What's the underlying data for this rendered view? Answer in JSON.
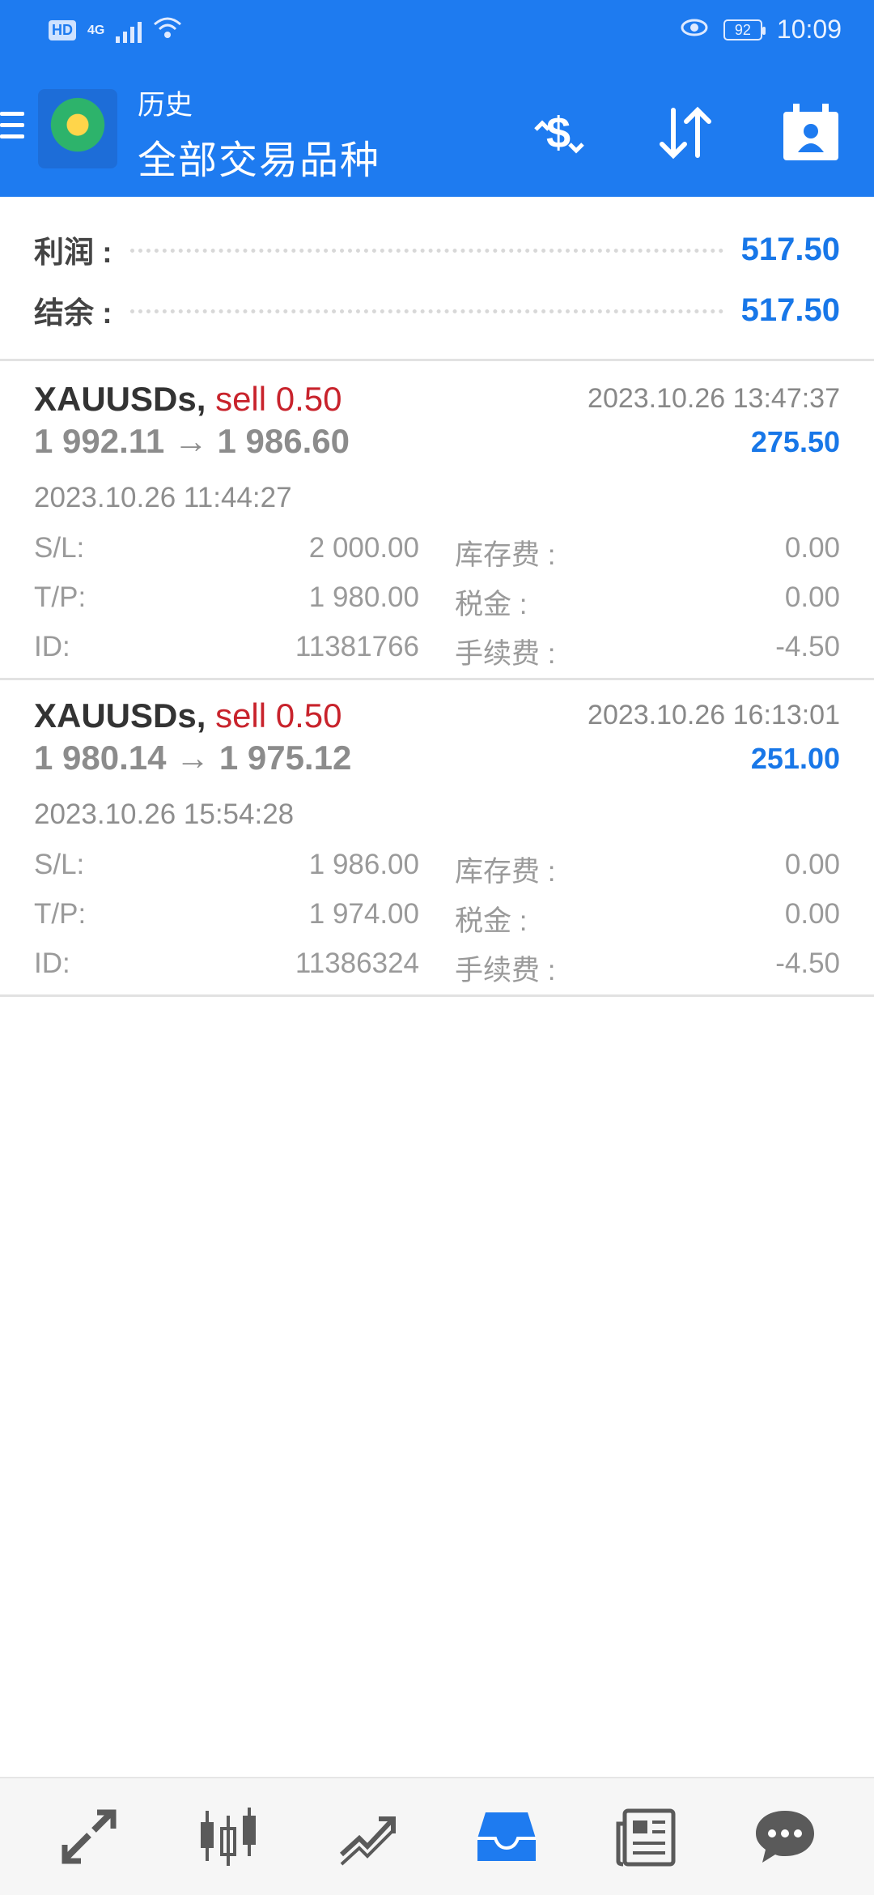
{
  "status_bar": {
    "hd_label": "HD",
    "network_label": "4G",
    "battery": "92",
    "time": "10:09"
  },
  "header": {
    "title_small": "历史",
    "title_big": "全部交易品种"
  },
  "summary": {
    "profit_label": "利润 :",
    "profit_value": "517.50",
    "balance_label": "结余 :",
    "balance_value": "517.50"
  },
  "deals": [
    {
      "symbol": "XAUUSDs,",
      "type": "sell 0.50",
      "close_time": "2023.10.26 13:47:37",
      "prices": "1 992.11 → 1 986.60",
      "profit": "275.50",
      "open_time": "2023.10.26 11:44:27",
      "sl_label": "S/L:",
      "sl": "2 000.00",
      "tp_label": "T/P:",
      "tp": "1 980.00",
      "id_label": "ID:",
      "id": "11381766",
      "swap_label": "库存费 :",
      "swap": "0.00",
      "tax_label": "税金 :",
      "tax": "0.00",
      "commission_label": "手续费 :",
      "commission": "-4.50"
    },
    {
      "symbol": "XAUUSDs,",
      "type": "sell 0.50",
      "close_time": "2023.10.26 16:13:01",
      "prices": "1 980.14 → 1 975.12",
      "profit": "251.00",
      "open_time": "2023.10.26 15:54:28",
      "sl_label": "S/L:",
      "sl": "1 986.00",
      "tp_label": "T/P:",
      "tp": "1 974.00",
      "id_label": "ID:",
      "id": "11386324",
      "swap_label": "库存费 :",
      "swap": "0.00",
      "tax_label": "税金 :",
      "tax": "0.00",
      "commission_label": "手续费 :",
      "commission": "-4.50"
    }
  ],
  "bottom_nav": {
    "items": [
      "quotes-icon",
      "chart-icon",
      "trade-icon",
      "history-icon",
      "news-icon",
      "chat-icon"
    ],
    "active": "history-icon"
  },
  "colors": {
    "header_bg": "#1e7bf0",
    "value_blue": "#1877e8",
    "sell_red": "#c8232c",
    "active_nav": "#1e7bf0"
  }
}
